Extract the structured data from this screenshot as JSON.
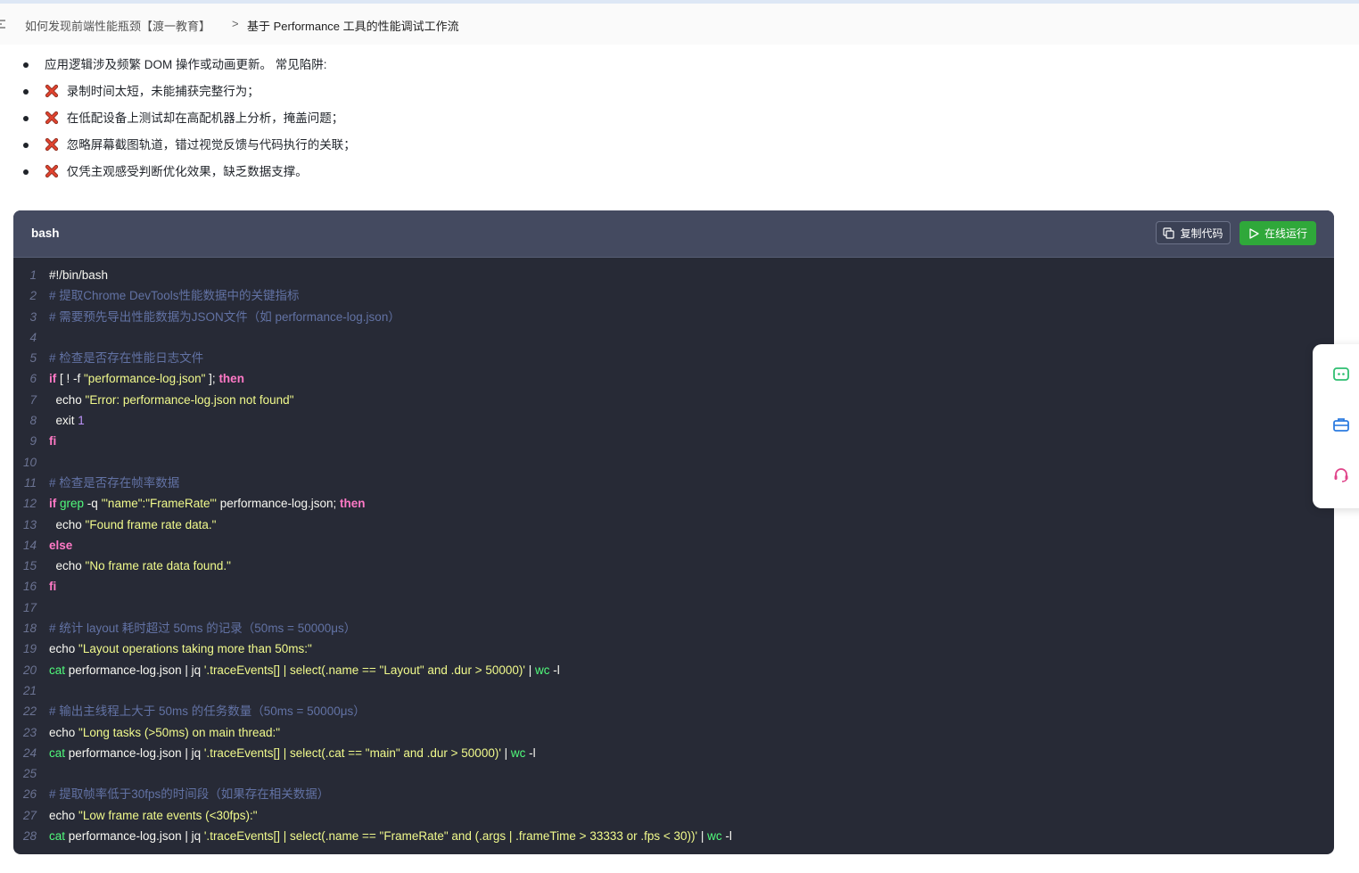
{
  "breadcrumb": {
    "parent": "如何发现前端性能瓶颈【渡一教育】",
    "separator": ">",
    "current": "基于 Performance 工具的性能调试工作流"
  },
  "bullets": [
    {
      "icon": "none",
      "text": "应用逻辑涉及频繁 DOM 操作或动画更新。 常见陷阱:"
    },
    {
      "icon": "cross-mark-icon",
      "text": "录制时间太短，未能捕获完整行为；"
    },
    {
      "icon": "cross-mark-icon",
      "text": "在低配设备上测试却在高配机器上分析，掩盖问题；"
    },
    {
      "icon": "cross-mark-icon",
      "text": "忽略屏幕截图轨道，错过视觉反馈与代码执行的关联；"
    },
    {
      "icon": "cross-mark-icon",
      "text": "仅凭主观感受判断优化效果，缺乏数据支撑。"
    }
  ],
  "code_block": {
    "language": "bash",
    "copy_label": "复制代码",
    "run_label": "在线运行",
    "lines": [
      [
        [
          "p",
          "#!/bin/bash"
        ]
      ],
      [
        [
          "cm",
          "# 提取Chrome DevTools性能数据中的关键指标"
        ]
      ],
      [
        [
          "cm",
          "# 需要预先导出性能数据为JSON文件（如 performance-log.json）"
        ]
      ],
      [],
      [
        [
          "cm",
          "# 检查是否存在性能日志文件"
        ]
      ],
      [
        [
          "kw",
          "if"
        ],
        [
          "p",
          " [ ! -f "
        ],
        [
          "st",
          "\"performance-log.json\""
        ],
        [
          "p",
          " ]; "
        ],
        [
          "kw",
          "then"
        ]
      ],
      [
        [
          "p",
          "  echo "
        ],
        [
          "st",
          "\"Error: performance-log.json not found\""
        ]
      ],
      [
        [
          "p",
          "  exit "
        ],
        [
          "nu",
          "1"
        ]
      ],
      [
        [
          "kw",
          "fi"
        ]
      ],
      [],
      [
        [
          "cm",
          "# 检查是否存在帧率数据"
        ]
      ],
      [
        [
          "kw",
          "if"
        ],
        [
          "p",
          " "
        ],
        [
          "fn",
          "grep"
        ],
        [
          "p",
          " -q "
        ],
        [
          "st",
          "'\"name\":\"FrameRate\"'"
        ],
        [
          "p",
          " performance-log.json; "
        ],
        [
          "kw",
          "then"
        ]
      ],
      [
        [
          "p",
          "  echo "
        ],
        [
          "st",
          "\"Found frame rate data.\""
        ]
      ],
      [
        [
          "kw",
          "else"
        ]
      ],
      [
        [
          "p",
          "  echo "
        ],
        [
          "st",
          "\"No frame rate data found.\""
        ]
      ],
      [
        [
          "kw",
          "fi"
        ]
      ],
      [],
      [
        [
          "cm",
          "# 统计 layout 耗时超过 50ms 的记录（50ms = 50000μs）"
        ]
      ],
      [
        [
          "p",
          "echo "
        ],
        [
          "st",
          "\"Layout operations taking more than 50ms:\""
        ]
      ],
      [
        [
          "fn",
          "cat"
        ],
        [
          "p",
          " performance-log.json | jq "
        ],
        [
          "st",
          "'.traceEvents[] | select(.name == \"Layout\" and .dur > 50000)'"
        ],
        [
          "p",
          " | "
        ],
        [
          "fn",
          "wc"
        ],
        [
          "p",
          " -l"
        ]
      ],
      [],
      [
        [
          "cm",
          "# 输出主线程上大于 50ms 的任务数量（50ms = 50000μs）"
        ]
      ],
      [
        [
          "p",
          "echo "
        ],
        [
          "st",
          "\"Long tasks (>50ms) on main thread:\""
        ]
      ],
      [
        [
          "fn",
          "cat"
        ],
        [
          "p",
          " performance-log.json | jq "
        ],
        [
          "st",
          "'.traceEvents[] | select(.cat == \"main\" and .dur > 50000)'"
        ],
        [
          "p",
          " | "
        ],
        [
          "fn",
          "wc"
        ],
        [
          "p",
          " -l"
        ]
      ],
      [],
      [
        [
          "cm",
          "# 提取帧率低于30fps的时间段（如果存在相关数据）"
        ]
      ],
      [
        [
          "p",
          "echo "
        ],
        [
          "st",
          "\"Low frame rate events (<30fps):\""
        ]
      ],
      [
        [
          "fn",
          "cat"
        ],
        [
          "p",
          " performance-log.json | jq "
        ],
        [
          "st",
          "'.traceEvents[] | select(.name == \"FrameRate\" and (.args | .frameTime > 33333 or .fps < 30))'"
        ],
        [
          "p",
          " | "
        ],
        [
          "fn",
          "wc"
        ],
        [
          "p",
          " -l"
        ]
      ]
    ]
  },
  "side_panel": {
    "icons": [
      "chat-icon",
      "toolbox-icon",
      "headset-icon"
    ]
  },
  "colors": {
    "code_bg": "#272a36",
    "code_header_bg": "#444a60",
    "run_button": "#2fa83a",
    "comment": "#6272a4",
    "keyword": "#ff79c6",
    "string": "#f1fa8c",
    "number": "#bd93f9",
    "function": "#50fa7b"
  }
}
